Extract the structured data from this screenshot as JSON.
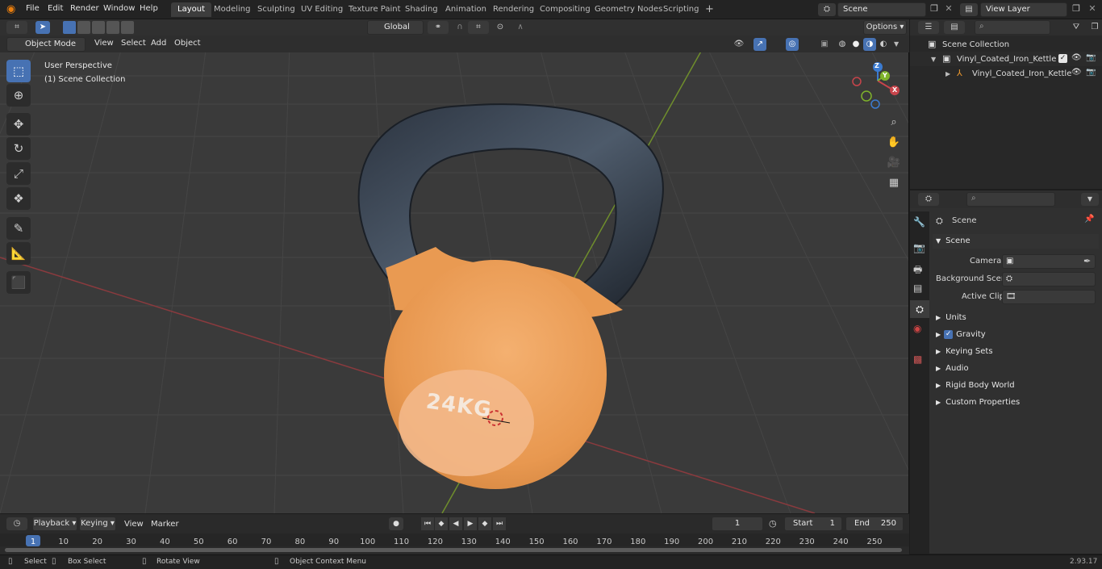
{
  "topbar": {
    "menus": [
      "File",
      "Edit",
      "Render",
      "Window",
      "Help"
    ],
    "workspaces": [
      "Layout",
      "Modeling",
      "Sculpting",
      "UV Editing",
      "Texture Paint",
      "Shading",
      "Animation",
      "Rendering",
      "Compositing",
      "Geometry Nodes",
      "Scripting"
    ],
    "active_workspace": "Layout",
    "add_tab": "+",
    "scene_name": "Scene",
    "view_layer": "View Layer"
  },
  "viewport_toolbar": {
    "orientation": "Global",
    "options": "Options"
  },
  "viewport_header": {
    "mode": "Object Mode",
    "menus": [
      "View",
      "Select",
      "Add",
      "Object"
    ]
  },
  "viewport": {
    "perspective": "User Perspective",
    "collection": "(1) Scene Collection",
    "kettlebell_label": "24KG",
    "gizmo": {
      "x": "X",
      "y": "Y",
      "z": "Z"
    }
  },
  "outliner": {
    "root": "Scene Collection",
    "items": [
      {
        "label": "Vinyl_Coated_Iron_Kettlebell_"
      },
      {
        "label": "Vinyl_Coated_Iron_Kettle"
      }
    ]
  },
  "properties": {
    "context": "Scene",
    "section": "Scene",
    "fields": [
      {
        "label": "Camera"
      },
      {
        "label": "Background Scene"
      },
      {
        "label": "Active Clip"
      }
    ],
    "panels": [
      "Units",
      "Gravity",
      "Keying Sets",
      "Audio",
      "Rigid Body World",
      "Custom Properties"
    ],
    "gravity_checked": true
  },
  "timeline": {
    "menus": [
      "Playback",
      "Keying",
      "View",
      "Marker"
    ],
    "current_frame": "1",
    "start_label": "Start",
    "start": "1",
    "end_label": "End",
    "end": "250",
    "ruler": [
      "1",
      "10",
      "20",
      "30",
      "40",
      "50",
      "60",
      "70",
      "80",
      "90",
      "100",
      "110",
      "120",
      "130",
      "140",
      "150",
      "160",
      "170",
      "180",
      "190",
      "200",
      "210",
      "220",
      "230",
      "240",
      "250"
    ]
  },
  "statusbar": {
    "select": "Select",
    "box_select": "Box Select",
    "rotate": "Rotate View",
    "context_menu": "Object Context Menu",
    "version": "2.93.17"
  },
  "colors": {
    "accent": "#4772b3",
    "kettlebell_orange": "#f0a25a",
    "handle": "#3a4552",
    "x_axis": "#c7444b",
    "y_axis": "#7fb32b",
    "z_axis": "#3b7bd1"
  }
}
